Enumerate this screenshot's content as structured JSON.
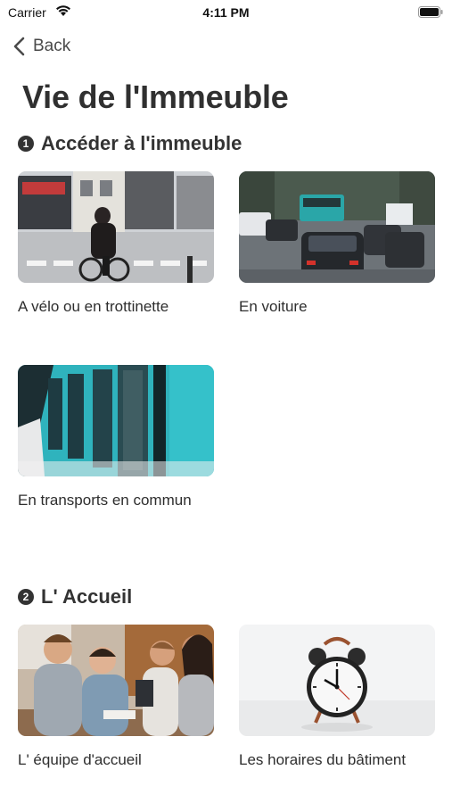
{
  "status_bar": {
    "carrier": "Carrier",
    "time": "4:11 PM"
  },
  "nav": {
    "back_label": "Back"
  },
  "page": {
    "title": "Vie de l'Immeuble"
  },
  "sections": [
    {
      "number": "1",
      "title": "Accéder à l'immeuble",
      "cards": [
        {
          "label": "A vélo ou en trottinette",
          "image": "cyclist-street-photo"
        },
        {
          "label": "En voiture",
          "image": "traffic-cars-photo"
        },
        {
          "label": "En transports en commun",
          "image": "metro-train-photo"
        }
      ]
    },
    {
      "number": "2",
      "title": "L' Accueil",
      "cards": [
        {
          "label": "L' équipe d'accueil",
          "image": "team-meeting-photo"
        },
        {
          "label": "Les horaires du bâtiment",
          "image": "alarm-clock-photo"
        }
      ]
    }
  ]
}
